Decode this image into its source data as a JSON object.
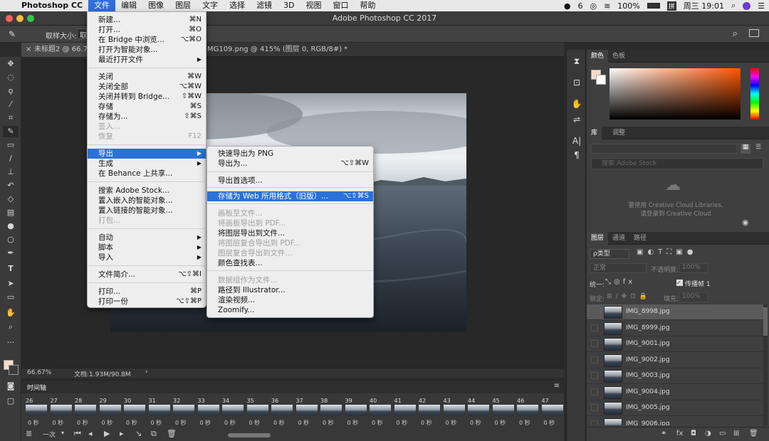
{
  "menubar": {
    "app_name": "Photoshop CC",
    "menus": [
      "文件",
      "编辑",
      "图像",
      "图层",
      "文字",
      "选择",
      "滤镜",
      "3D",
      "视图",
      "窗口",
      "帮助"
    ],
    "wechat_count": "6",
    "battery": "100%",
    "input_method": "拼",
    "clock": "周三 19:01"
  },
  "window": {
    "title": "Adobe Photoshop CC 2017"
  },
  "options_bar": {
    "sample_size_label": "取样大小:",
    "sample_size_value": "取"
  },
  "doc_tabs": [
    {
      "label": "未标题2 @ 66.7%..."
    },
    {
      "label": "IMG109.png @ 415% (图层 0, RGB/8#) *"
    }
  ],
  "file_menu": {
    "items": [
      {
        "label": "新建...",
        "shortcut": "⌘N"
      },
      {
        "label": "打开...",
        "shortcut": "⌘O"
      },
      {
        "label": "在 Bridge 中浏览...",
        "shortcut": "⌥⌘O"
      },
      {
        "label": "打开为智能对象..."
      },
      {
        "label": "最近打开文件",
        "arrow": "▶"
      },
      {
        "label": "关闭",
        "shortcut": "⌘W"
      },
      {
        "label": "关闭全部",
        "shortcut": "⌥⌘W"
      },
      {
        "label": "关闭并转到 Bridge...",
        "shortcut": "⇧⌘W"
      },
      {
        "label": "存储",
        "shortcut": "⌘S"
      },
      {
        "label": "存储为...",
        "shortcut": "⇧⌘S"
      },
      {
        "label": "签入..."
      },
      {
        "label": "恢复",
        "shortcut": "F12"
      },
      {
        "label": "导出",
        "arrow": "▶"
      },
      {
        "label": "生成",
        "arrow": "▶"
      },
      {
        "label": "在 Behance 上共享..."
      },
      {
        "label": "搜索 Adobe Stock..."
      },
      {
        "label": "置入嵌入的智能对象..."
      },
      {
        "label": "置入链接的智能对象..."
      },
      {
        "label": "打包..."
      },
      {
        "label": "自动",
        "arrow": "▶"
      },
      {
        "label": "脚本",
        "arrow": "▶"
      },
      {
        "label": "导入",
        "arrow": "▶"
      },
      {
        "label": "文件简介...",
        "shortcut": "⌥⇧⌘I"
      },
      {
        "label": "打印...",
        "shortcut": "⌘P"
      },
      {
        "label": "打印一份",
        "shortcut": "⌥⇧⌘P"
      }
    ]
  },
  "export_submenu": {
    "items": [
      {
        "label": "快速导出为 PNG"
      },
      {
        "label": "导出为...",
        "shortcut": "⌥⇧⌘W"
      },
      {
        "label": "导出首选项..."
      },
      {
        "label": "存储为 Web 所用格式（旧版）...",
        "shortcut": "⌥⇧⌘S"
      },
      {
        "label": "画板至文件..."
      },
      {
        "label": "将画板导出到 PDF..."
      },
      {
        "label": "将图层导出到文件..."
      },
      {
        "label": "将图层复合导出到 PDF..."
      },
      {
        "label": "图层复合导出到文件..."
      },
      {
        "label": "颜色查找表..."
      },
      {
        "label": "数据组作为文件..."
      },
      {
        "label": "路径到 Illustrator..."
      },
      {
        "label": "渲染视频..."
      },
      {
        "label": "Zoomify..."
      }
    ]
  },
  "status_bar": {
    "zoom": "66.67%",
    "doc_info": "文档:1.93M/90.8M"
  },
  "timeline": {
    "title": "时间轴",
    "frames": [
      "26",
      "27",
      "28",
      "29",
      "30",
      "31",
      "32",
      "33",
      "34",
      "35",
      "36",
      "37",
      "38",
      "39",
      "40",
      "41",
      "42",
      "43",
      "44",
      "45",
      "46",
      "47"
    ],
    "frame_duration": "0 秒",
    "loop": "一次"
  },
  "color_panel": {
    "tabs": [
      "颜色",
      "色板"
    ],
    "foreground": "#f6dccb",
    "hue_top": "#ff5500"
  },
  "library_panel": {
    "tabs": [
      "库",
      "调整"
    ],
    "message_line1": "要使用 Creative Cloud Libraries,",
    "message_line2": "请登录到 Creative Cloud",
    "search_placeholder": "搜索 Adobe Stock"
  },
  "layers_panel": {
    "tabs": [
      "图层",
      "通道",
      "路径"
    ],
    "filter_kind": "ρ类型",
    "blend_mode": "正常",
    "opacity_label": "不透明度:",
    "opacity_value": "100%",
    "unify_label": "统一:",
    "propagate_label": "传播帧 1",
    "lock_label": "锁定:",
    "fill_label": "填充:",
    "fill_value": "100%",
    "layers": [
      "IMG_8998.jpg",
      "IMG_8999.jpg",
      "IMG_9001.jpg",
      "IMG_9002.jpg",
      "IMG_9003.jpg",
      "IMG_9004.jpg",
      "IMG_9005.jpg",
      "IMG_9006.jpg"
    ]
  }
}
